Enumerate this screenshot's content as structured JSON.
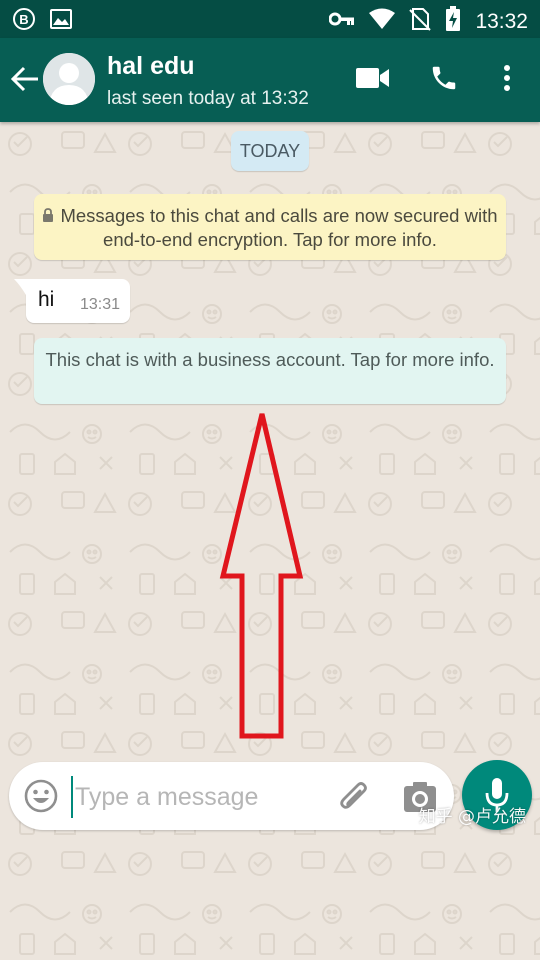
{
  "status_bar": {
    "time": "13:32",
    "icons": [
      "b-app-icon",
      "image-icon",
      "vpn-key-icon",
      "wifi-icon",
      "no-sim-icon",
      "battery-charging-icon"
    ]
  },
  "header": {
    "contact_name": "hal edu",
    "contact_status": "last seen today at 13:32",
    "actions": [
      "back-arrow-icon",
      "video-call-icon",
      "phone-icon",
      "more-vert-icon"
    ]
  },
  "chat": {
    "date_divider": "TODAY",
    "encryption_notice": "Messages to this chat and calls are now secured with end-to-end encryption. Tap for more info.",
    "messages": [
      {
        "direction": "incoming",
        "text": "hi",
        "time": "13:31"
      }
    ],
    "business_notice": "This chat is with a business account. Tap for more info."
  },
  "composer": {
    "placeholder": "Type a message"
  },
  "watermark": "知乎 @卢允德",
  "colors": {
    "status_bar": "#054d44",
    "toolbar": "#075e54",
    "accent": "#00897b",
    "wallpaper": "#ece5dd",
    "encryption_notice_bg": "#fcf4c4",
    "business_notice_bg": "#e2f5f1",
    "date_chip_bg": "#d4eaf4",
    "annotation_arrow": "#e0161d"
  }
}
